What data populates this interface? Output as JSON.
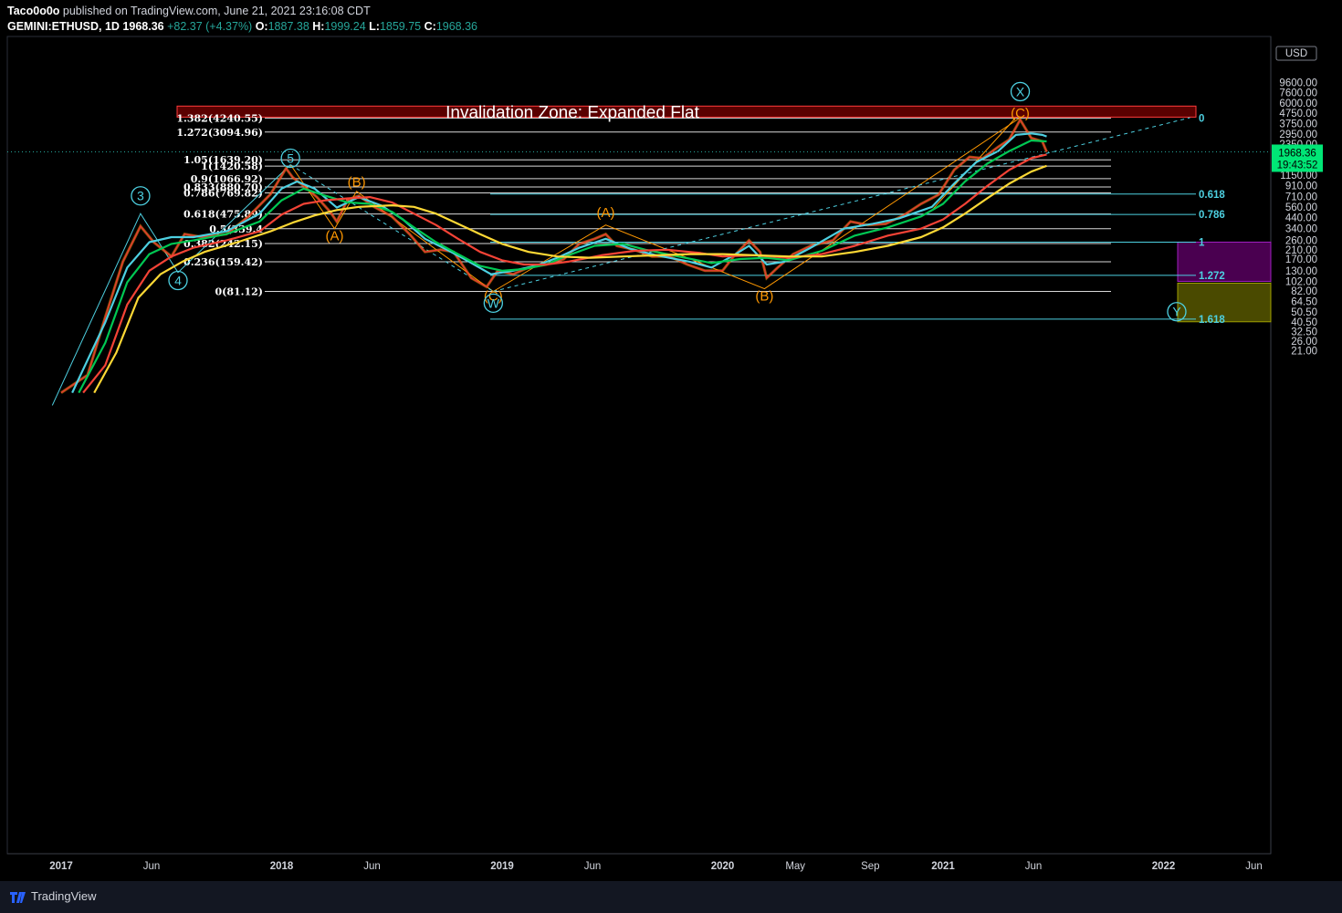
{
  "header": {
    "author": "Taco0o0o",
    "published": "published on TradingView.com, June 21, 2021 23:16:08 CDT",
    "symbol": "GEMINI:ETHUSD, 1D",
    "last": "1968.36",
    "change": "+82.37 (+4.37%)",
    "o_label": "O:",
    "o_val": "1887.38",
    "h_label": "H:",
    "h_val": "1999.24",
    "l_label": "L:",
    "l_val": "1859.75",
    "c_label": "C:",
    "c_val": "1968.36"
  },
  "footer": {
    "brand": "TradingView"
  },
  "colors": {
    "background": "#000000",
    "up": "#26a69a",
    "candle_up": "#ff9800",
    "candle_down": "#e53935",
    "ma_cyan": "#4dd0e1",
    "ma_green": "#00c853",
    "ma_red": "#f44336",
    "ma_yellow": "#fdd835",
    "wave_orange": "#ff9800",
    "zone_red": "#5a0000",
    "box_purple": "#4a0050",
    "box_olive": "#4a4a00"
  },
  "chart_data": {
    "type": "line",
    "scale": "log",
    "currency": "USD",
    "y_ticks": [
      "9600.00",
      "7600.00",
      "6000.00",
      "4750.00",
      "3750.00",
      "2950.00",
      "2350.00",
      "1450.00",
      "1150.00",
      "910.00",
      "710.00",
      "560.00",
      "440.00",
      "340.00",
      "260.00",
      "210.00",
      "170.00",
      "130.00",
      "102.00",
      "82.00",
      "64.50",
      "50.50",
      "40.50",
      "32.50",
      "26.00",
      "21.00"
    ],
    "x_ticks": [
      "2017",
      "Jun",
      "2018",
      "Jun",
      "2019",
      "Jun",
      "2020",
      "May",
      "Sep",
      "2021",
      "Jun",
      "2022",
      "Jun"
    ],
    "last_price": "1968.36",
    "countdown": "19:43:52",
    "zone_label": "Invalidation Zone: Expanded Flat",
    "fib_left": [
      {
        "label": "1.382(4240.55)",
        "value": 4240.55
      },
      {
        "label": "1.272(3094.96)",
        "value": 3094.96
      },
      {
        "label": "1.05(1639.20)",
        "value": 1639.2
      },
      {
        "label": "1(1420.58)",
        "value": 1420.58
      },
      {
        "label": "0.9(1066.92)",
        "value": 1066.92
      },
      {
        "label": "0.833(880.70)",
        "value": 880.7
      },
      {
        "label": "0.786(769.82)",
        "value": 769.82
      },
      {
        "label": "0.618(475.89)",
        "value": 475.89
      },
      {
        "label": "0.5(339.4",
        "value": 339.4
      },
      {
        "label": "0.382(242.15)",
        "value": 242.15
      },
      {
        "label": "0.236(159.42)",
        "value": 159.42
      },
      {
        "label": "0(81.12)",
        "value": 81.12
      }
    ],
    "fib_right": [
      {
        "label": "0",
        "value": 4240
      },
      {
        "label": "0.618",
        "value": 750
      },
      {
        "label": "0.786",
        "value": 470
      },
      {
        "label": "1",
        "value": 250
      },
      {
        "label": "1.272",
        "value": 117
      },
      {
        "label": "1.618",
        "value": 43
      }
    ],
    "waves": [
      {
        "label": "3",
        "t": 2017.36,
        "p": 720
      },
      {
        "label": "4",
        "t": 2017.53,
        "p": 104
      },
      {
        "label": "5",
        "t": 2018.04,
        "p": 1700
      },
      {
        "label": "(A)",
        "t": 2018.24,
        "p": 290
      },
      {
        "label": "(B)",
        "t": 2018.34,
        "p": 990
      },
      {
        "label": "(C)",
        "t": 2018.96,
        "p": 73
      },
      {
        "label": "W",
        "t": 2018.96,
        "p": 62
      },
      {
        "label": "(A)",
        "t": 2019.47,
        "p": 490
      },
      {
        "label": "(B)",
        "t": 2020.19,
        "p": 73
      },
      {
        "label": "(C)",
        "t": 2021.35,
        "p": 4750
      },
      {
        "label": "X",
        "t": 2021.35,
        "p": 7800
      },
      {
        "label": "Y",
        "t": 2022.06,
        "p": 51
      }
    ],
    "price_points": [
      [
        2017.0,
        8
      ],
      [
        2017.12,
        12
      ],
      [
        2017.2,
        45
      ],
      [
        2017.28,
        160
      ],
      [
        2017.36,
        360
      ],
      [
        2017.42,
        250
      ],
      [
        2017.5,
        180
      ],
      [
        2017.56,
        300
      ],
      [
        2017.64,
        280
      ],
      [
        2017.75,
        300
      ],
      [
        2017.85,
        450
      ],
      [
        2017.95,
        750
      ],
      [
        2018.02,
        1350
      ],
      [
        2018.05,
        1100
      ],
      [
        2018.1,
        900
      ],
      [
        2018.16,
        700
      ],
      [
        2018.22,
        500
      ],
      [
        2018.25,
        400
      ],
      [
        2018.3,
        660
      ],
      [
        2018.35,
        720
      ],
      [
        2018.42,
        560
      ],
      [
        2018.5,
        450
      ],
      [
        2018.58,
        300
      ],
      [
        2018.65,
        200
      ],
      [
        2018.72,
        210
      ],
      [
        2018.78,
        200
      ],
      [
        2018.86,
        110
      ],
      [
        2018.93,
        90
      ],
      [
        2018.98,
        130
      ],
      [
        2019.05,
        120
      ],
      [
        2019.12,
        140
      ],
      [
        2019.2,
        150
      ],
      [
        2019.28,
        170
      ],
      [
        2019.35,
        240
      ],
      [
        2019.42,
        270
      ],
      [
        2019.47,
        300
      ],
      [
        2019.52,
        230
      ],
      [
        2019.6,
        210
      ],
      [
        2019.68,
        180
      ],
      [
        2019.76,
        180
      ],
      [
        2019.84,
        150
      ],
      [
        2019.92,
        130
      ],
      [
        2020.0,
        130
      ],
      [
        2020.05,
        180
      ],
      [
        2020.12,
        260
      ],
      [
        2020.17,
        200
      ],
      [
        2020.2,
        110
      ],
      [
        2020.25,
        140
      ],
      [
        2020.32,
        190
      ],
      [
        2020.4,
        230
      ],
      [
        2020.5,
        260
      ],
      [
        2020.58,
        400
      ],
      [
        2020.66,
        370
      ],
      [
        2020.74,
        380
      ],
      [
        2020.82,
        460
      ],
      [
        2020.9,
        600
      ],
      [
        2020.98,
        740
      ],
      [
        2021.05,
        1300
      ],
      [
        2021.12,
        1750
      ],
      [
        2021.18,
        1700
      ],
      [
        2021.25,
        2200
      ],
      [
        2021.3,
        2600
      ],
      [
        2021.35,
        4100
      ],
      [
        2021.4,
        2700
      ],
      [
        2021.45,
        2500
      ],
      [
        2021.47,
        1970
      ]
    ],
    "ma_series": [
      {
        "values": [
          [
            2017.05,
            8
          ],
          [
            2017.2,
            40
          ],
          [
            2017.3,
            140
          ],
          [
            2017.4,
            250
          ],
          [
            2017.5,
            280
          ],
          [
            2017.6,
            280
          ],
          [
            2017.75,
            320
          ],
          [
            2017.9,
            480
          ],
          [
            2018.0,
            850
          ],
          [
            2018.07,
            1000
          ],
          [
            2018.15,
            850
          ],
          [
            2018.25,
            550
          ],
          [
            2018.35,
            700
          ],
          [
            2018.45,
            580
          ],
          [
            2018.55,
            420
          ],
          [
            2018.65,
            270
          ],
          [
            2018.75,
            210
          ],
          [
            2018.85,
            160
          ],
          [
            2018.95,
            120
          ],
          [
            2019.05,
            130
          ],
          [
            2019.15,
            145
          ],
          [
            2019.25,
            175
          ],
          [
            2019.35,
            220
          ],
          [
            2019.47,
            270
          ],
          [
            2019.58,
            215
          ],
          [
            2019.7,
            185
          ],
          [
            2019.85,
            160
          ],
          [
            2019.95,
            140
          ],
          [
            2020.05,
            185
          ],
          [
            2020.12,
            230
          ],
          [
            2020.2,
            150
          ],
          [
            2020.28,
            160
          ],
          [
            2020.4,
            220
          ],
          [
            2020.55,
            340
          ],
          [
            2020.68,
            380
          ],
          [
            2020.8,
            430
          ],
          [
            2020.95,
            560
          ],
          [
            2021.05,
            950
          ],
          [
            2021.15,
            1550
          ],
          [
            2021.25,
            2000
          ],
          [
            2021.33,
            2900
          ],
          [
            2021.4,
            3000
          ],
          [
            2021.45,
            2900
          ],
          [
            2021.47,
            2800
          ]
        ]
      },
      {
        "values": [
          [
            2017.08,
            8
          ],
          [
            2017.2,
            25
          ],
          [
            2017.3,
            100
          ],
          [
            2017.4,
            190
          ],
          [
            2017.5,
            240
          ],
          [
            2017.6,
            260
          ],
          [
            2017.75,
            300
          ],
          [
            2017.9,
            400
          ],
          [
            2018.0,
            650
          ],
          [
            2018.1,
            850
          ],
          [
            2018.2,
            720
          ],
          [
            2018.3,
            620
          ],
          [
            2018.4,
            600
          ],
          [
            2018.5,
            500
          ],
          [
            2018.6,
            350
          ],
          [
            2018.7,
            250
          ],
          [
            2018.8,
            190
          ],
          [
            2018.9,
            145
          ],
          [
            2019.0,
            130
          ],
          [
            2019.1,
            135
          ],
          [
            2019.2,
            150
          ],
          [
            2019.3,
            185
          ],
          [
            2019.42,
            230
          ],
          [
            2019.55,
            240
          ],
          [
            2019.65,
            210
          ],
          [
            2019.8,
            180
          ],
          [
            2019.95,
            155
          ],
          [
            2020.08,
            170
          ],
          [
            2020.2,
            175
          ],
          [
            2020.3,
            165
          ],
          [
            2020.45,
            205
          ],
          [
            2020.6,
            290
          ],
          [
            2020.75,
            350
          ],
          [
            2020.9,
            450
          ],
          [
            2021.0,
            600
          ],
          [
            2021.1,
            1000
          ],
          [
            2021.2,
            1500
          ],
          [
            2021.3,
            2000
          ],
          [
            2021.4,
            2550
          ],
          [
            2021.47,
            2500
          ]
        ]
      },
      {
        "values": [
          [
            2017.1,
            8
          ],
          [
            2017.2,
            15
          ],
          [
            2017.3,
            60
          ],
          [
            2017.4,
            130
          ],
          [
            2017.5,
            180
          ],
          [
            2017.6,
            220
          ],
          [
            2017.75,
            260
          ],
          [
            2017.9,
            320
          ],
          [
            2018.0,
            470
          ],
          [
            2018.1,
            600
          ],
          [
            2018.2,
            650
          ],
          [
            2018.3,
            680
          ],
          [
            2018.4,
            700
          ],
          [
            2018.5,
            620
          ],
          [
            2018.6,
            480
          ],
          [
            2018.7,
            370
          ],
          [
            2018.8,
            270
          ],
          [
            2018.9,
            200
          ],
          [
            2019.0,
            165
          ],
          [
            2019.1,
            150
          ],
          [
            2019.2,
            150
          ],
          [
            2019.3,
            160
          ],
          [
            2019.45,
            185
          ],
          [
            2019.6,
            205
          ],
          [
            2019.75,
            210
          ],
          [
            2019.9,
            195
          ],
          [
            2020.0,
            180
          ],
          [
            2020.15,
            185
          ],
          [
            2020.3,
            175
          ],
          [
            2020.45,
            190
          ],
          [
            2020.6,
            230
          ],
          [
            2020.75,
            290
          ],
          [
            2020.9,
            340
          ],
          [
            2021.0,
            420
          ],
          [
            2021.1,
            600
          ],
          [
            2021.2,
            900
          ],
          [
            2021.3,
            1300
          ],
          [
            2021.4,
            1700
          ],
          [
            2021.47,
            1850
          ]
        ]
      },
      {
        "values": [
          [
            2017.15,
            8
          ],
          [
            2017.25,
            20
          ],
          [
            2017.35,
            70
          ],
          [
            2017.45,
            120
          ],
          [
            2017.55,
            160
          ],
          [
            2017.65,
            200
          ],
          [
            2017.8,
            250
          ],
          [
            2017.95,
            320
          ],
          [
            2018.05,
            390
          ],
          [
            2018.15,
            460
          ],
          [
            2018.25,
            520
          ],
          [
            2018.35,
            560
          ],
          [
            2018.5,
            580
          ],
          [
            2018.6,
            560
          ],
          [
            2018.7,
            480
          ],
          [
            2018.8,
            380
          ],
          [
            2018.9,
            300
          ],
          [
            2019.0,
            240
          ],
          [
            2019.12,
            200
          ],
          [
            2019.25,
            180
          ],
          [
            2019.4,
            175
          ],
          [
            2019.55,
            180
          ],
          [
            2019.7,
            185
          ],
          [
            2019.85,
            190
          ],
          [
            2020.0,
            190
          ],
          [
            2020.15,
            185
          ],
          [
            2020.3,
            180
          ],
          [
            2020.45,
            180
          ],
          [
            2020.6,
            200
          ],
          [
            2020.75,
            230
          ],
          [
            2020.9,
            280
          ],
          [
            2021.0,
            350
          ],
          [
            2021.1,
            480
          ],
          [
            2021.2,
            680
          ],
          [
            2021.3,
            950
          ],
          [
            2021.4,
            1250
          ],
          [
            2021.47,
            1430
          ]
        ]
      }
    ],
    "grid": false,
    "legend": "none"
  }
}
